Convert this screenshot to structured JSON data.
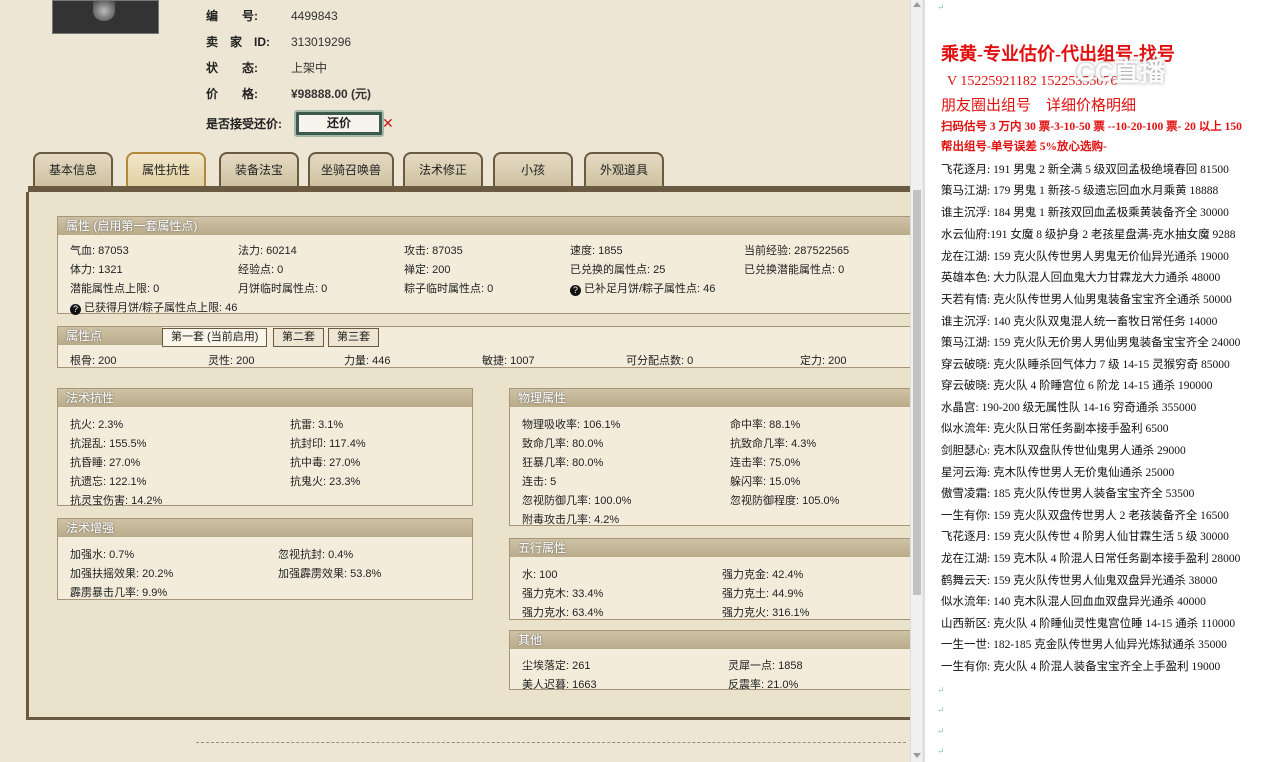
{
  "item_info": {
    "id_label": "编　　号:",
    "id_value": "4499843",
    "seller_label": "卖　家　ID:",
    "seller_value": "313019296",
    "status_label": "状　　态:",
    "status_value": "上架中",
    "price_label": "价　　格:",
    "price_value": "¥98888.00 (元)",
    "haggle_label": "是否接受还价:",
    "haggle_button": "还价",
    "close_symbol": "✕"
  },
  "tabs": [
    "基本信息",
    "属性抗性",
    "装备法宝",
    "坐骑召唤兽",
    "法术修正",
    "小孩",
    "外观道具"
  ],
  "active_tab": "属性抗性",
  "attrs": {
    "title": "属性 (启用第一套属性点)",
    "items": [
      "气血: 87053",
      "法力: 60214",
      "攻击: 87035",
      "速度: 1855",
      "当前经验: 287522565",
      "体力: 1321",
      "经验点: 0",
      "禅定: 200",
      "已兑换的属性点: 25",
      "已兑换潜能属性点: 0",
      "潜能属性点上限: 0",
      "月饼临时属性点: 0",
      "粽子临时属性点: 0",
      "已补足月饼/粽子属性点: 46",
      "已获得月饼/粽子属性点上限: 46"
    ]
  },
  "points": {
    "title": "属性点",
    "subtabs": [
      "第一套 (当前启用)",
      "第二套",
      "第三套"
    ],
    "items": [
      "根骨: 200",
      "灵性: 200",
      "力量: 446",
      "敏捷: 1007",
      "可分配点数: 0",
      "定力: 200"
    ]
  },
  "resist": {
    "title": "法术抗性",
    "items": [
      "抗火: 2.3%",
      "抗雷: 3.1%",
      "抗混乱: 155.5%",
      "抗封印: 117.4%",
      "抗昏睡: 27.0%",
      "抗中毒: 27.0%",
      "抗遗忘: 122.1%",
      "抗鬼火: 23.3%",
      "抗灵宝伤害: 14.2%"
    ]
  },
  "enhance": {
    "title": "法术增强",
    "items": [
      "加强水: 0.7%",
      "忽视抗封: 0.4%",
      "加强扶摇效果: 20.2%",
      "加强霹雳效果: 53.8%",
      "霹雳暴击几率: 9.9%"
    ]
  },
  "physical": {
    "title": "物理属性",
    "items": [
      "物理吸收率: 106.1%",
      "命中率: 88.1%",
      "致命几率: 80.0%",
      "抗致命几率: 4.3%",
      "狂暴几率: 80.0%",
      "连击率: 75.0%",
      "连击: 5",
      "躲闪率: 15.0%",
      "忽视防御几率: 100.0%",
      "忽视防御程度: 105.0%",
      "附毒攻击几率: 4.2%"
    ]
  },
  "elements": {
    "title": "五行属性",
    "items": [
      "水: 100",
      "强力克金: 42.4%",
      "强力克木: 33.4%",
      "强力克土: 44.9%",
      "强力克水: 63.4%",
      "强力克火: 316.1%"
    ]
  },
  "other": {
    "title": "其他",
    "items": [
      "尘埃落定: 261",
      "灵犀一点: 1858",
      "美人迟暮: 1663",
      "反震率: 21.0%"
    ]
  },
  "doc": {
    "title": "乘黄-专业估价-代出组号-找号",
    "contact": "V 15225921182   15225355076",
    "line2": "朋友圈出组号　详细价格明细",
    "line3": "扫码估号 3 万内 30 票-3-10-50 票 --10-20-100 票- 20 以上 150",
    "line4": "帮出组号-单号误差 5%放心选购-",
    "watermark": "CC直播",
    "entries": [
      "飞花逐月: 191 男鬼 2 新全满 5 级双回孟极绝境春回 81500",
      "策马江湖: 179 男鬼 1 新孩-5 级遗忘回血水月乘黄 18888",
      "谁主沉浮: 184 男鬼 1 新孩双回血孟极乘黄装备齐全 30000",
      "水云仙府:191 女魔 8 级护身 2 老孩星盘满-克水抽女魔 9288",
      "龙在江湖: 159 克火队传世男人男鬼无价仙异光通杀 19000",
      "英雄本色: 大力队混人回血鬼大力甘霖龙大力通杀 48000",
      "天若有情: 克火队传世男人仙男鬼装备宝宝齐全通杀 50000",
      "谁主沉浮: 140 克火队双鬼混人统一畜牧日常任务 14000",
      "策马江湖: 159 克火队无价男人男仙男鬼装备宝宝齐全 24000",
      "穿云破晓: 克火队睡杀回气体力 7 级 14-15 灵猴穷奇 85000",
      "穿云破晓: 克火队 4 阶睡宫位 6 阶龙 14-15 通杀 190000",
      "水晶宫: 190-200 级无属性队 14-16 穷奇通杀 355000",
      "似水流年: 克火队日常任务副本接手盈利 6500",
      "剑胆瑟心: 克木队双盘队传世仙鬼男人通杀 29000",
      "星河云海: 克木队传世男人无价鬼仙通杀 25000",
      "傲雪凌霜: 185 克火队传世男人装备宝宝齐全 53500",
      "一生有你: 159 克火队双盘传世男人 2 老孩装备齐全 16500",
      "飞花逐月: 159 克火队传世 4 阶男人仙甘霖生活 5 级 30000",
      "龙在江湖: 159 克木队 4 阶混人日常任务副本接手盈利 28000",
      "鹤舞云天: 159 克火队传世男人仙鬼双盘异光通杀 38000",
      "似水流年: 140 克木队混人回血血双盘异光通杀 40000",
      "山西新区: 克火队 4 阶睡仙灵性鬼宫位睡 14-15 通杀 110000",
      "一生一世: 182-185 克金队传世男人仙异光炼狱通杀 35000",
      "一生有你: 克火队 4 阶混人装备宝宝齐全上手盈利 19000"
    ],
    "para_mark": "↵"
  }
}
